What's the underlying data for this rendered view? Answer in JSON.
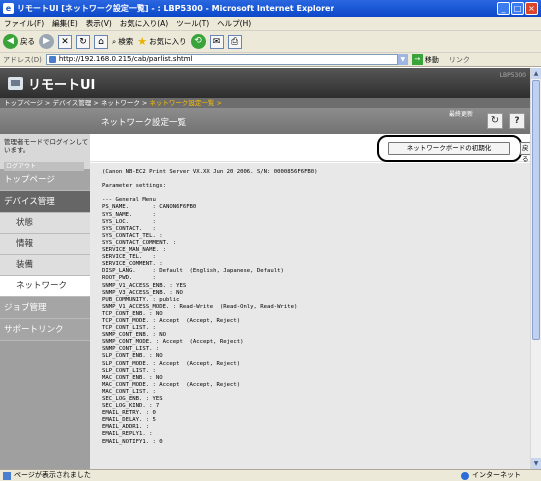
{
  "window": {
    "title": "リモートUI [ネットワーク設定一覧] - : LBP5300 - Microsoft Internet Explorer",
    "controls": [
      "_",
      "□",
      "×"
    ]
  },
  "menubar": [
    "ファイル(F)",
    "編集(E)",
    "表示(V)",
    "お気に入り(A)",
    "ツール(T)",
    "ヘルプ(H)"
  ],
  "toolbar": {
    "back_label": "戻る",
    "search_label": "検索",
    "favorites_label": "お気に入り"
  },
  "address": {
    "label": "アドレス(D)",
    "url": "http://192.168.0.215/cab/parlist.shtml",
    "go_label": "移動",
    "links_label": "リンク"
  },
  "banner": {
    "logo": "リモートUI",
    "product": "LBP5300"
  },
  "breadcrumb": {
    "path": "トップページ > デバイス管理 > ネットワーク > ",
    "current": "ネットワーク設定一覧 >"
  },
  "header": {
    "page_title": "ネットワーク設定一覧",
    "last_update_label": "最終更新",
    "refresh_icon": "↻",
    "help_label": "?"
  },
  "sidebar": {
    "admin_note": "管理者モードでログインしています。",
    "logout": "ログアウト",
    "items": [
      {
        "label": "トップページ"
      },
      {
        "label": "デバイス管理"
      },
      {
        "label": "状態"
      },
      {
        "label": "情報"
      },
      {
        "label": "装備"
      },
      {
        "label": "ネットワーク"
      },
      {
        "label": "ジョブ管理"
      },
      {
        "label": "サポートリンク"
      }
    ]
  },
  "content": {
    "reset_button": "ネットワークボードの初期化",
    "back_button": "戻る",
    "params_text": "(Canon NB-EC2 Print Server VX.XX Jun 20 2006. S/N: 0000856F6FB0)\n\nParameter settings:\n\n--- General Menu\nPS_NAME.       : CANON6F6FB0\nSYS_NAME.      :\nSYS_LOC.       :\nSYS_CONTACT.   :\nSYS_CONTACT_TEL. :\nSYS_CONTACT_COMMENT. :\nSERVICE_MAN_NAME. :\nSERVICE_TEL.   :\nSERVICE_COMMENT. :\nDISP_LANG.     : Default  (English, Japanese, Default)\nROOT_PWD.      :\nSNMP_V1_ACCESS_ENB. : YES\nSNMP_V3_ACCESS_ENB. : NO\nPUB_COMMUNITY. : public\nSNMP_V1_ACCESS_MODE. : Read-Write  (Read-Only, Read-Write)\nTCP_CONT_ENB. : NO\nTCP_CONT_MODE. : Accept  (Accept, Reject)\nTCP_CONT_LIST. :\nSNMP_CONT_ENB. : NO\nSNMP_CONT_MODE. : Accept  (Accept, Reject)\nSNMP_CONT_LIST. :\nSLP_CONT_ENB. : NO\nSLP_CONT_MODE. : Accept  (Accept, Reject)\nSLP_CONT_LIST. :\nMAC_CONT_ENB. : NO\nMAC_CONT_MODE. : Accept  (Accept, Reject)\nMAC_CONT_LIST. :\nSEC_LOG_ENB. : YES\nSEC_LOG_KIND. : 7\nEMAIL_RETRY. : 0\nEMAIL_DELAY. : 5\nEMAIL_ADDR1. :\nEMAIL_REPLY1. :\nEMAIL_NOTIFY1. : 0"
  },
  "statusbar": {
    "message": "ページが表示されました",
    "zone": "インターネット"
  }
}
